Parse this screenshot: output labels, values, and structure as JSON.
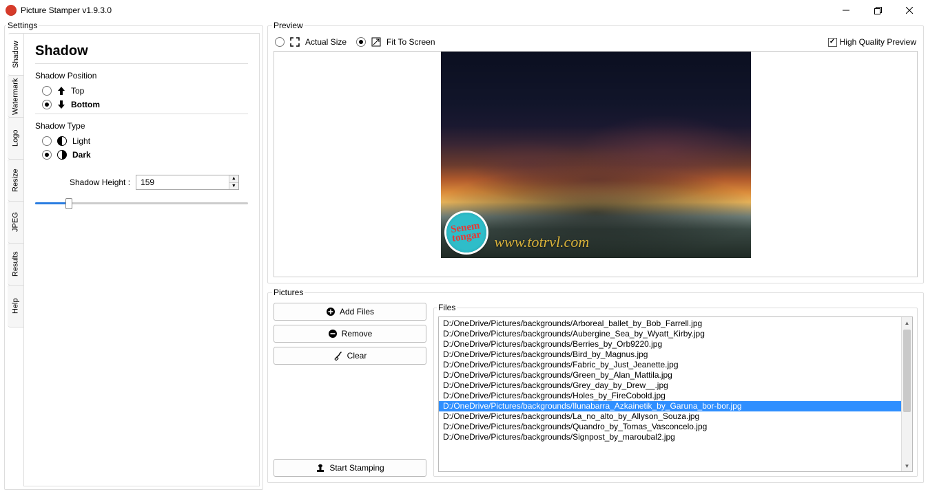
{
  "app": {
    "title": "Picture Stamper v1.9.3.0"
  },
  "settings": {
    "legend": "Settings",
    "tabs": [
      "Shadow",
      "Watermark",
      "Logo",
      "Resize",
      "JPEG",
      "Results",
      "Help"
    ],
    "active_tab": "Shadow",
    "shadow": {
      "heading": "Shadow",
      "position_label": "Shadow Position",
      "options_position": {
        "top": "Top",
        "bottom": "Bottom"
      },
      "position_selected": "bottom",
      "type_label": "Shadow Type",
      "options_type": {
        "light": "Light",
        "dark": "Dark"
      },
      "type_selected": "dark",
      "height_label": "Shadow Height :",
      "height_value": "159",
      "slider_percent": 16
    }
  },
  "preview": {
    "legend": "Preview",
    "actual_size": "Actual Size",
    "fit_to_screen": "Fit To Screen",
    "mode": "fit",
    "high_quality": "High Quality Preview",
    "high_quality_checked": true,
    "watermark_text": "www.totrvl.com",
    "stamp_text": "Senem\ntongar"
  },
  "pictures": {
    "legend": "Pictures",
    "buttons": {
      "add": "Add Files",
      "remove": "Remove",
      "clear": "Clear",
      "start": "Start Stamping"
    },
    "files_legend": "Files",
    "selected_index": 8,
    "files": [
      "D:/OneDrive/Pictures/backgrounds/Arboreal_ballet_by_Bob_Farrell.jpg",
      "D:/OneDrive/Pictures/backgrounds/Aubergine_Sea_by_Wyatt_Kirby.jpg",
      "D:/OneDrive/Pictures/backgrounds/Berries_by_Orb9220.jpg",
      "D:/OneDrive/Pictures/backgrounds/Bird_by_Magnus.jpg",
      "D:/OneDrive/Pictures/backgrounds/Fabric_by_Just_Jeanette.jpg",
      "D:/OneDrive/Pictures/backgrounds/Green_by_Alan_Mattila.jpg",
      "D:/OneDrive/Pictures/backgrounds/Grey_day_by_Drew__.jpg",
      "D:/OneDrive/Pictures/backgrounds/Holes_by_FireCobold.jpg",
      "D:/OneDrive/Pictures/backgrounds/Ilunabarra_Azkainetik_by_Garuna_bor-bor.jpg",
      "D:/OneDrive/Pictures/backgrounds/La_no_alto_by_Allyson_Souza.jpg",
      "D:/OneDrive/Pictures/backgrounds/Quandro_by_Tomas_Vasconcelo.jpg",
      "D:/OneDrive/Pictures/backgrounds/Signpost_by_maroubal2.jpg"
    ]
  }
}
